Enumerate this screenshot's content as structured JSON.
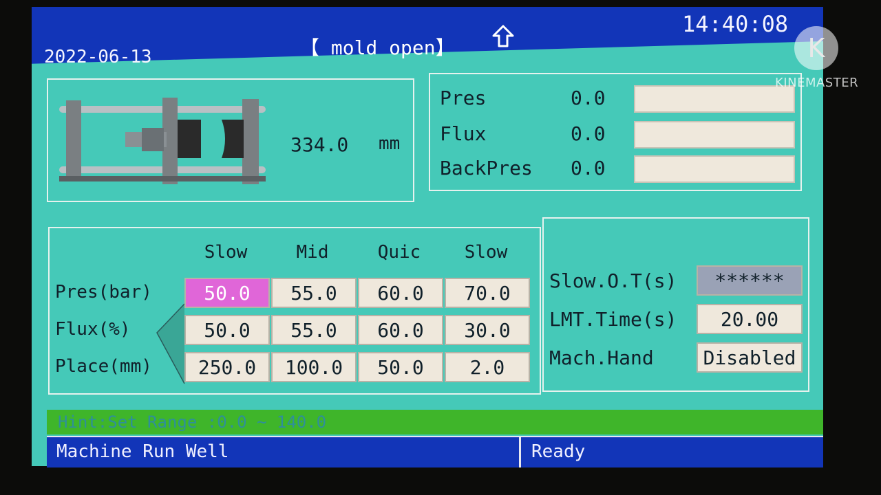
{
  "header": {
    "date": "2022-06-13",
    "mode": "【 mold open】",
    "time": "14:40:08",
    "arrow_icon": "up-arrow-icon"
  },
  "mold": {
    "position_value": "334.0",
    "position_unit": "mm"
  },
  "gauges": [
    {
      "label": "Pres",
      "value": "0.0",
      "level": 0
    },
    {
      "label": "Flux",
      "value": "0.0",
      "level": 0
    },
    {
      "label": "BackPres",
      "value": "0.0",
      "level": 0
    }
  ],
  "table": {
    "columns": [
      "Slow",
      "Mid",
      "Quic",
      "Slow"
    ],
    "rows": [
      {
        "label": "Pres(bar)",
        "values": [
          "50.0",
          "55.0",
          "60.0",
          "70.0"
        ]
      },
      {
        "label": "Flux(%)",
        "values": [
          "50.0",
          "55.0",
          "60.0",
          "30.0"
        ]
      },
      {
        "label": "Place(mm)",
        "values": [
          "250.0",
          "100.0",
          "50.0",
          "2.0"
        ]
      }
    ],
    "selected_cell": "Pres(bar) / Slow"
  },
  "options": [
    {
      "label": "Slow.O.T(s)",
      "value": "******"
    },
    {
      "label": "LMT.Time(s)",
      "value": "20.00"
    },
    {
      "label": "Mach.Hand",
      "value": "Disabled"
    }
  ],
  "hint": "Hint:Set Range :0.0 ~ 140.0",
  "status": {
    "left": "Machine Run Well",
    "right": "Ready"
  },
  "watermark": {
    "logo_letter": "K",
    "text": "KINEMASTER"
  },
  "colors": {
    "screen_bg": "#45c9b8",
    "bar_blue": "#1235b8",
    "hint_green": "#3fb52a",
    "active_cell": "#e066d8",
    "cell_bg": "#efe8dc"
  }
}
